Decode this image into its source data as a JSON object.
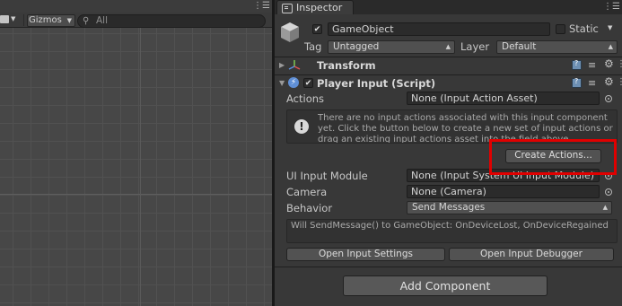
{
  "scene_view": {
    "toolbar": {
      "camera_icon": "camera-icon",
      "gizmos_label": "Gizmos",
      "search_placeholder": "All",
      "search_icon": "search-icon"
    }
  },
  "inspector": {
    "tab_label": "Inspector",
    "gameobject": {
      "active": true,
      "name": "GameObject",
      "static_label": "Static",
      "tag_label": "Tag",
      "tag_value": "Untagged",
      "layer_label": "Layer",
      "layer_value": "Default"
    },
    "transform": {
      "title": "Transform"
    },
    "player_input": {
      "title": "Player Input (Script)",
      "enabled": true,
      "actions_label": "Actions",
      "actions_value": "None (Input Action Asset)",
      "help_text": "There are no input actions associated with this input component yet. Click the button below to create a new set of input actions or drag an existing input actions asset into the field above.",
      "create_actions_label": "Create Actions...",
      "ui_input_module_label": "UI Input Module",
      "ui_input_module_value": "None (Input System UI Input Module)",
      "camera_label": "Camera",
      "camera_value": "None (Camera)",
      "behavior_label": "Behavior",
      "behavior_value": "Send Messages",
      "messages_info": "Will SendMessage() to GameObject: OnDeviceLost, OnDeviceRegained",
      "open_settings_label": "Open Input Settings",
      "open_debugger_label": "Open Input Debugger"
    },
    "add_component_label": "Add Component"
  },
  "colors": {
    "highlight": "#e00000",
    "panel_bg": "#383838",
    "scene_bg": "#474747"
  }
}
